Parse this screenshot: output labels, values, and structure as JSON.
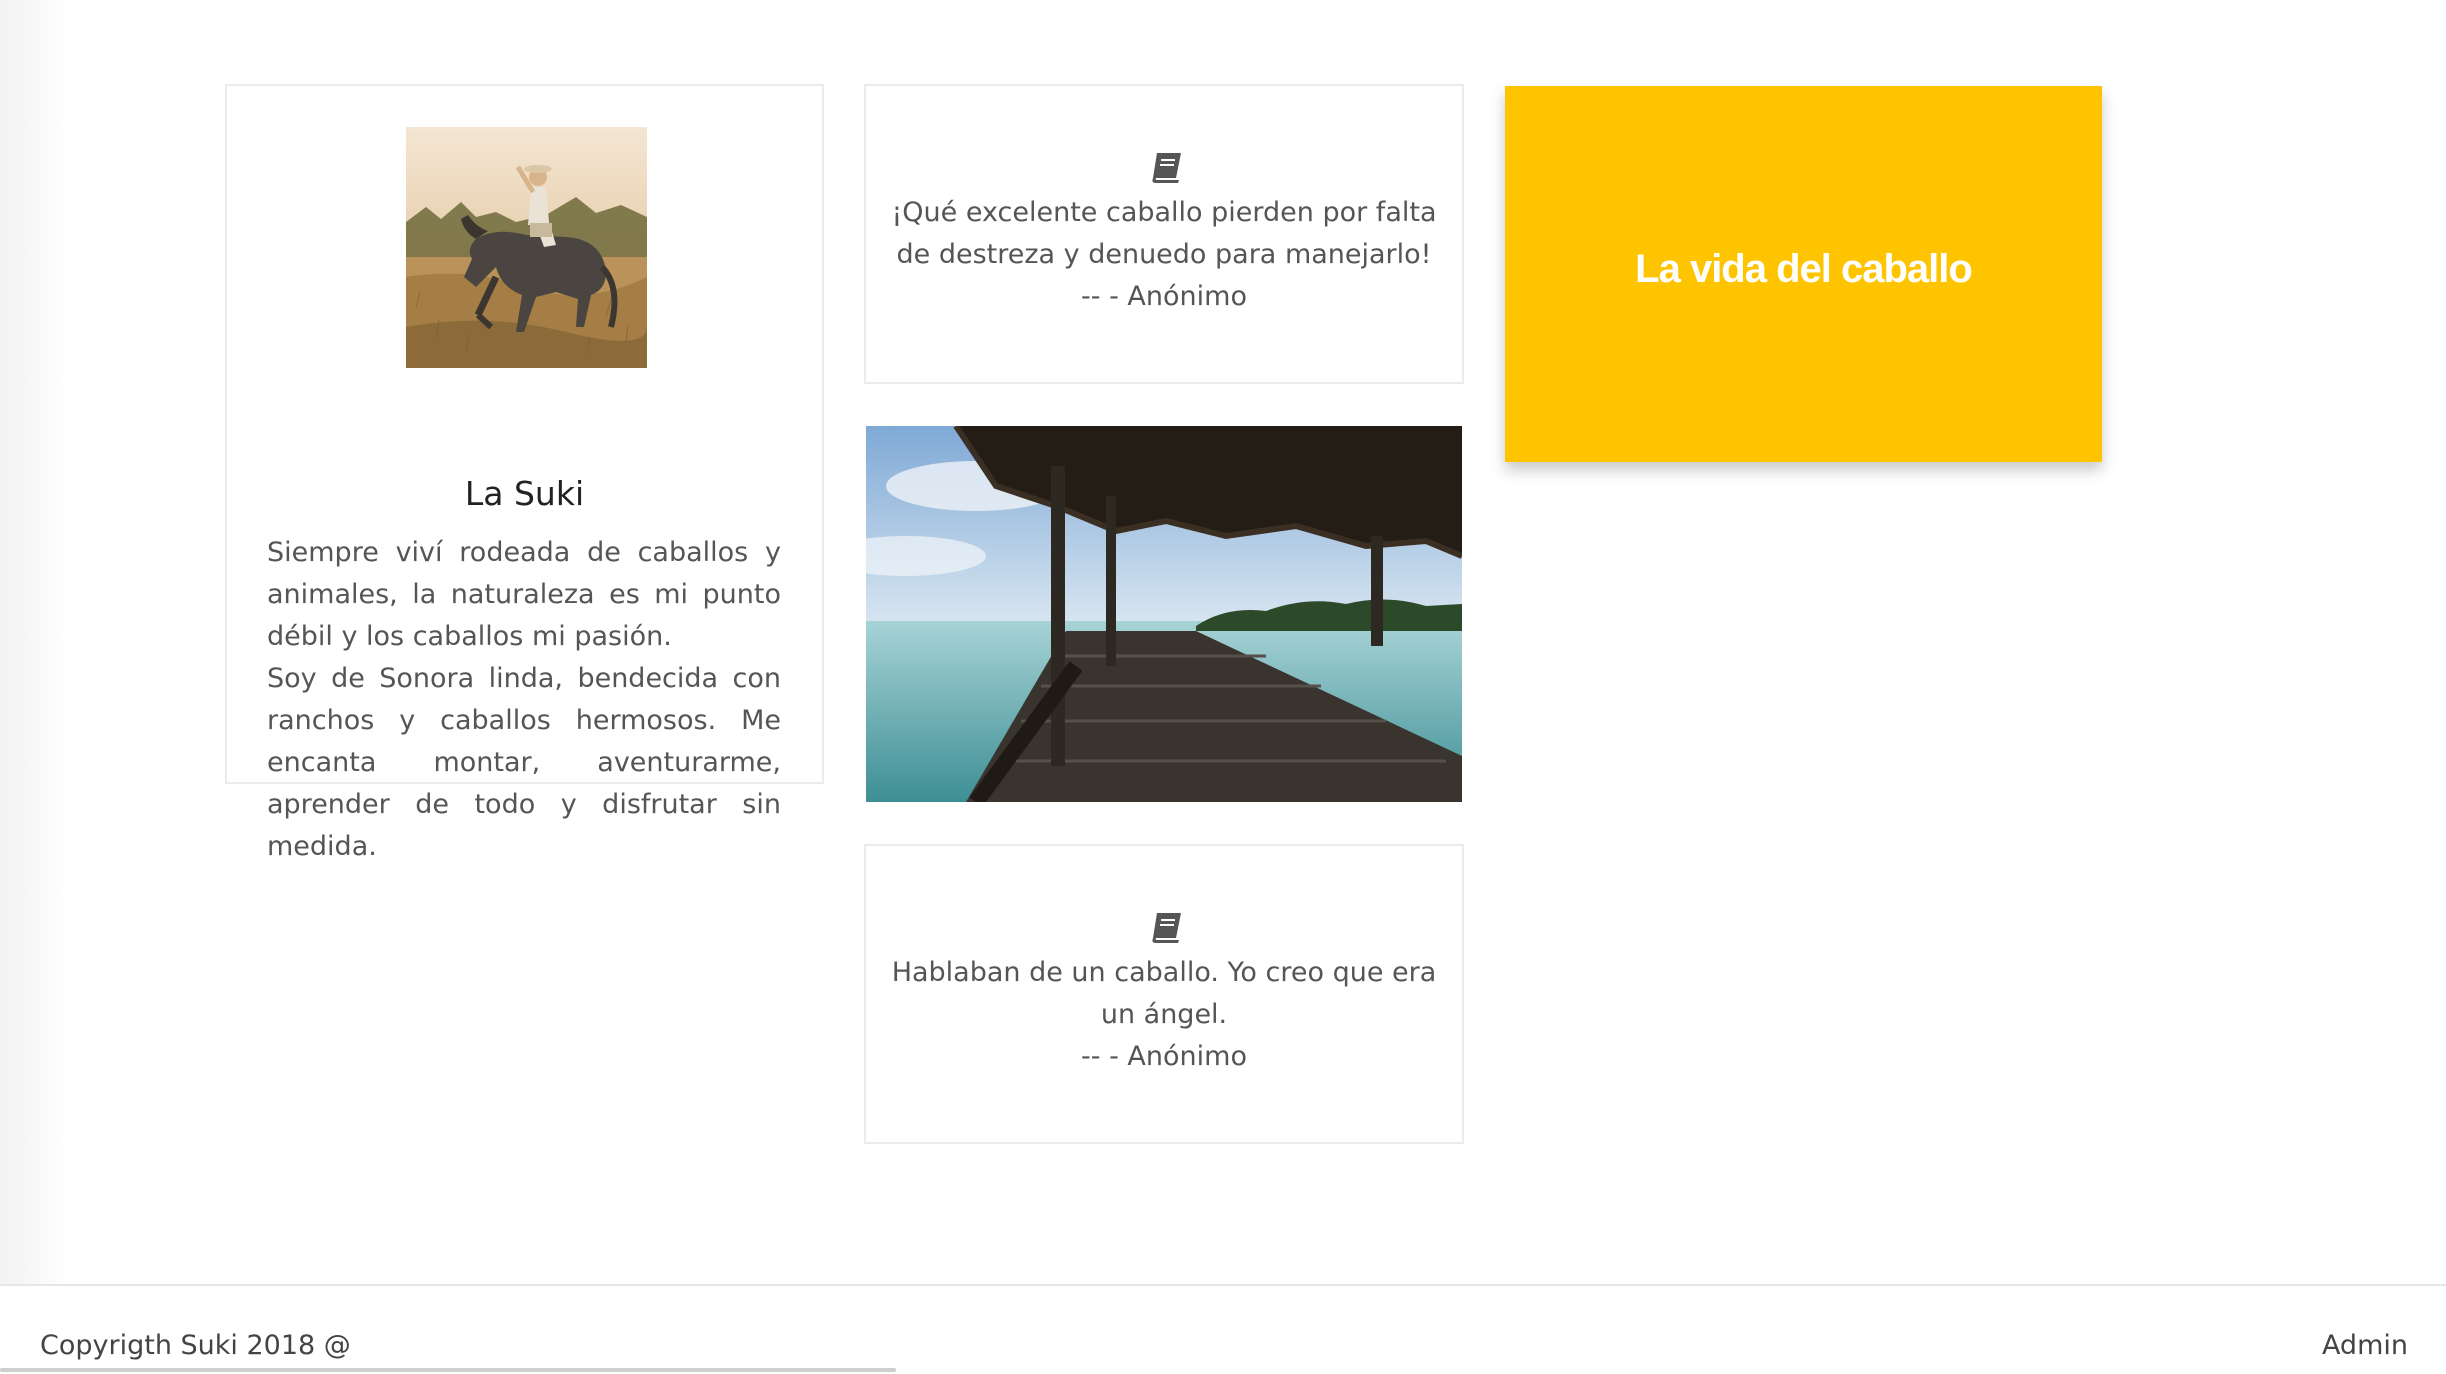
{
  "profile": {
    "name": "La Suki",
    "bio_paragraphs": [
      "Siempre viví rodeada de caballos y animales, la naturaleza es mi punto débil y los caballos mi pasión.",
      "Soy de Sonora linda, bendecida con ranchos y caballos hermosos. Me encanta montar, aventurarme, aprender de todo y disfrutar sin medida."
    ],
    "photo_icon": "horse-rider-photo"
  },
  "quotes": [
    {
      "icon": "book-icon",
      "text": "¡Qué excelente caballo pierden por falta de destreza y denuedo para manejarlo!",
      "author": "-- - Anónimo"
    },
    {
      "icon": "book-icon",
      "text": "Hablaban de un caballo. Yo creo que era un ángel.",
      "author": "-- - Anónimo"
    }
  ],
  "dock_image": {
    "icon": "lagoon-dock-photo"
  },
  "feature": {
    "title": "La vida del caballo",
    "background_color": "#ffc400",
    "text_color": "#ffffff"
  },
  "footer": {
    "copyright": "Copyrigth Suki 2018 @",
    "admin_link": "Admin"
  }
}
